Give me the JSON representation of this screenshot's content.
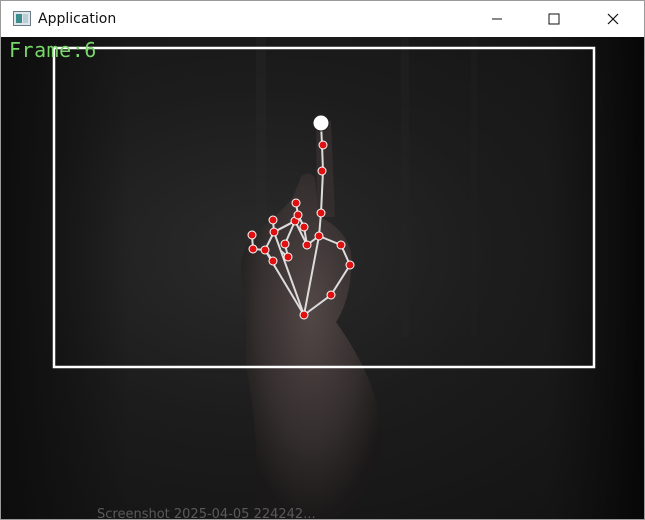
{
  "window": {
    "title": "Application",
    "icon": "app-window-icon"
  },
  "controls": {
    "minimize_icon": "minimize-icon",
    "maximize_icon": "maximize-icon",
    "close_icon": "close-icon"
  },
  "overlay": {
    "frame_text": "Frame:6",
    "frame_text_color": "#78d66a",
    "box_color": "#ffffff",
    "landmark_color": "#e01010",
    "fingertip_color": "#ffffff",
    "skeleton_color": "#dcdcdc"
  },
  "background": {
    "partial_text": "Screenshot 2025-04-05 224242..."
  }
}
